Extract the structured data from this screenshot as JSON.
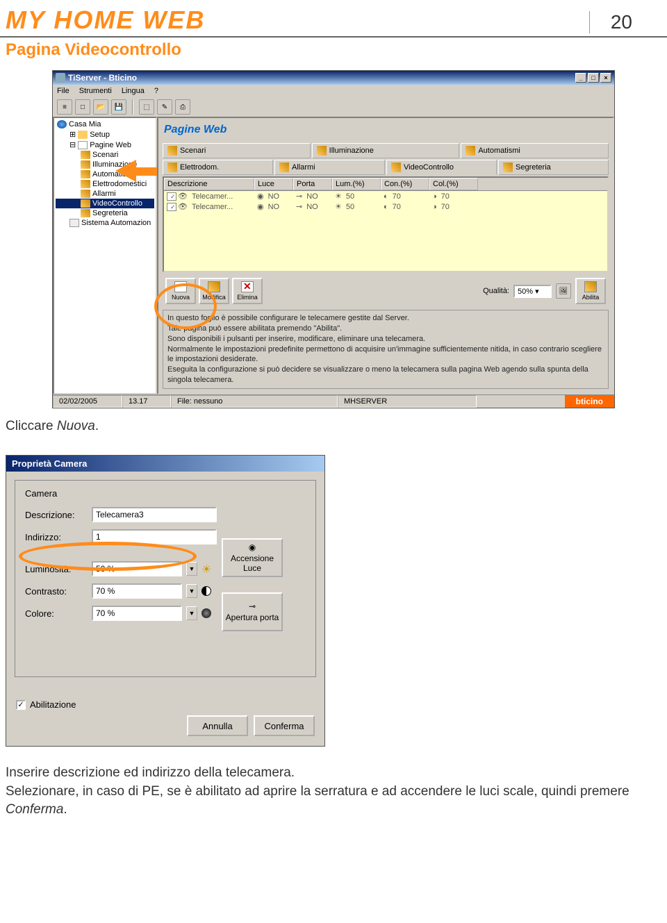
{
  "header": {
    "title": "MY HOME WEB",
    "page_number": "20",
    "subtitle": "Pagina Videocontrollo"
  },
  "window": {
    "title": "TiServer - Bticino",
    "menu": [
      "File",
      "Strumenti",
      "Lingua",
      "?"
    ],
    "tree": {
      "root": "Casa Mia",
      "setup": "Setup",
      "pagine_web": "Pagine Web",
      "items": [
        "Scenari",
        "Illuminazione",
        "Automatismi",
        "Elettrodomestici",
        "Allarmi",
        "VideoControllo",
        "Segreteria"
      ],
      "sistema": "Sistema Automazion"
    },
    "panel": {
      "heading": "Pagine Web",
      "tabs": [
        "Scenari",
        "Illuminazione",
        "Automatismi",
        "Elettrodom.",
        "Allarmi",
        "VideoControllo",
        "Segreteria"
      ],
      "columns": [
        "Descrizione",
        "Luce",
        "Porta",
        "Lum.(%)",
        "Con.(%)",
        "Col.(%)"
      ],
      "rows": [
        {
          "desc": "Telecamer...",
          "luce": "NO",
          "porta": "NO",
          "lum": "50",
          "con": "70",
          "col": "70"
        },
        {
          "desc": "Telecamer...",
          "luce": "NO",
          "porta": "NO",
          "lum": "50",
          "con": "70",
          "col": "70"
        }
      ],
      "buttons": {
        "nuova": "Nuova",
        "modifica": "Modifica",
        "elimina": "Elimina",
        "abilita": "Abilita"
      },
      "quality_label": "Qualità:",
      "quality_value": "50%",
      "help_text": "In questo foglio è possibile configurare le telecamere gestite dal Server.\nTale pagina può essere abilitata premendo \"Abilita\".\nSono disponibili i pulsanti per inserire, modificare, eliminare una telecamera.\nNormalmente le impostazioni predefinite permettono di acquisire un'immagine sufficientemente nitida, in caso contrario scegliere le impostazioni desiderate.\nEseguita la configurazione si può decidere se visualizzare o meno la telecamera sulla pagina Web agendo sulla spunta della singola telecamera."
    },
    "status": {
      "date": "02/02/2005",
      "time": "13.17",
      "file": "File: nessuno",
      "server": "MHSERVER",
      "brand": "bticino"
    }
  },
  "caption1": "Cliccare ",
  "caption1_em": "Nuova",
  "caption1_end": ".",
  "dialog": {
    "title": "Proprietà Camera",
    "fieldset_label": "Camera",
    "descrizione_label": "Descrizione:",
    "descrizione_value": "Telecamera3",
    "indirizzo_label": "Indirizzo:",
    "indirizzo_value": "1",
    "luminosita_label": "Luminosità:",
    "luminosita_value": "50 %",
    "contrasto_label": "Contrasto:",
    "contrasto_value": "70 %",
    "colore_label": "Colore:",
    "colore_value": "70 %",
    "accensione_label": "Accensione Luce",
    "apertura_label": "Apertura porta",
    "abilitazione_label": "Abilitazione",
    "annulla": "Annulla",
    "conferma": "Conferma"
  },
  "footer_text": "Inserire descrizione ed indirizzo della telecamera.\nSelezionare, in caso di PE, se è abilitato ad aprire la serratura e ad accendere le luci scale, quindi premere ",
  "footer_em": "Conferma",
  "footer_end": "."
}
